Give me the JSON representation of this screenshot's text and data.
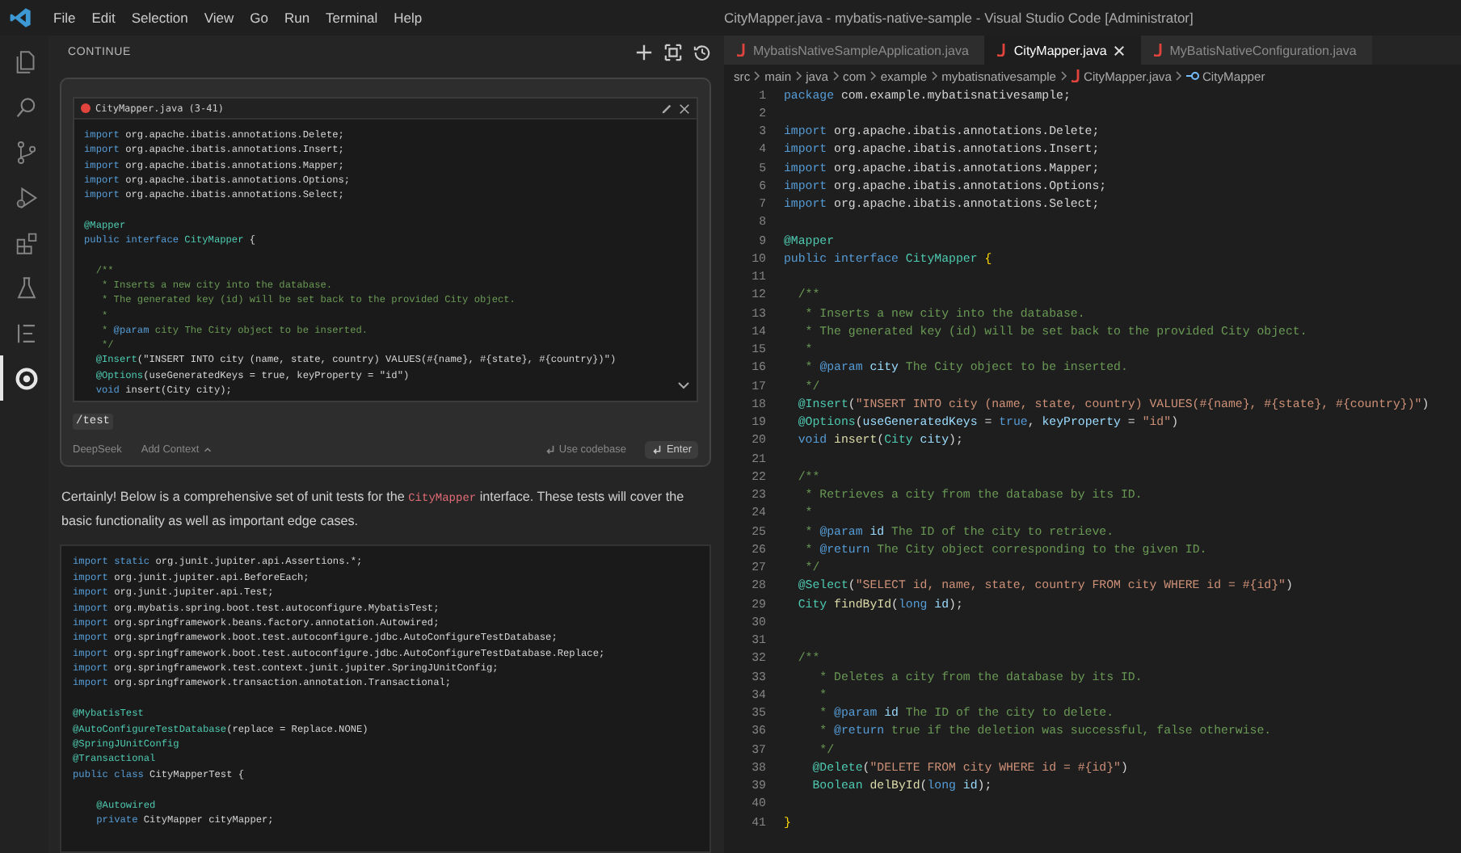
{
  "menu": [
    "File",
    "Edit",
    "Selection",
    "View",
    "Go",
    "Run",
    "Terminal",
    "Help"
  ],
  "window": {
    "title": "CityMapper.java - mybatis-native-sample - Visual Studio Code [Administrator]"
  },
  "activity_bar": [
    {
      "kind": "files",
      "selected": false
    },
    {
      "kind": "search",
      "selected": false
    },
    {
      "kind": "source-control",
      "selected": false
    },
    {
      "kind": "run",
      "selected": false
    },
    {
      "kind": "extensions",
      "selected": false
    },
    {
      "kind": "flask",
      "selected": false
    },
    {
      "kind": "outline",
      "selected": false
    },
    {
      "kind": "continue",
      "selected": true
    }
  ],
  "sidebar": {
    "title": "CONTINUE",
    "input": {
      "context": {
        "label": "CityMapper.java (3-41)",
        "lines": [
          {
            "kind": "code",
            "tokens": [
              {
                "kind": "keyword",
                "text": "import "
              },
              {
                "kind": "plain",
                "text": "org.apache.ibatis.annotations.Delete;"
              }
            ]
          },
          {
            "kind": "code",
            "tokens": [
              {
                "kind": "keyword",
                "text": "import "
              },
              {
                "kind": "plain",
                "text": "org.apache.ibatis.annotations.Insert;"
              }
            ]
          },
          {
            "kind": "code",
            "tokens": [
              {
                "kind": "keyword",
                "text": "import "
              },
              {
                "kind": "plain",
                "text": "org.apache.ibatis.annotations.Mapper;"
              }
            ]
          },
          {
            "kind": "code",
            "tokens": [
              {
                "kind": "keyword",
                "text": "import "
              },
              {
                "kind": "plain",
                "text": "org.apache.ibatis.annotations.Options;"
              }
            ]
          },
          {
            "kind": "code",
            "tokens": [
              {
                "kind": "keyword",
                "text": "import "
              },
              {
                "kind": "plain",
                "text": "org.apache.ibatis.annotations.Select;"
              }
            ]
          },
          {
            "kind": "blank"
          },
          {
            "kind": "code",
            "tokens": [
              {
                "kind": "type",
                "text": "@Mapper"
              }
            ]
          },
          {
            "kind": "code",
            "tokens": [
              {
                "kind": "keyword",
                "text": "public interface "
              },
              {
                "kind": "type",
                "text": "CityMapper "
              },
              {
                "kind": "plain",
                "text": "{"
              }
            ]
          },
          {
            "kind": "blank"
          },
          {
            "kind": "code",
            "tokens": [
              {
                "kind": "comment",
                "text": "  /**"
              }
            ]
          },
          {
            "kind": "code",
            "tokens": [
              {
                "kind": "comment",
                "text": "   * Inserts a new city into the database."
              }
            ]
          },
          {
            "kind": "code",
            "tokens": [
              {
                "kind": "comment",
                "text": "   * The generated key (id) will be set back to the provided City object."
              }
            ]
          },
          {
            "kind": "code",
            "tokens": [
              {
                "kind": "comment",
                "text": "   *"
              }
            ]
          },
          {
            "kind": "code",
            "tokens": [
              {
                "kind": "comment",
                "text": "   * "
              },
              {
                "kind": "doctag",
                "text": "@param"
              },
              {
                "kind": "comment",
                "text": " city The City object to be inserted."
              }
            ]
          },
          {
            "kind": "code",
            "tokens": [
              {
                "kind": "comment",
                "text": "   */"
              }
            ]
          },
          {
            "kind": "code",
            "tokens": [
              {
                "kind": "type",
                "text": "  @Insert"
              },
              {
                "kind": "plain",
                "text": "(\"INSERT INTO city (name, state, country) VALUES(#{name}, #{state}, #{country})\")"
              }
            ]
          },
          {
            "kind": "code",
            "tokens": [
              {
                "kind": "type",
                "text": "  @Options"
              },
              {
                "kind": "plain",
                "text": "(useGeneratedKeys = true, keyProperty = \"id\")"
              }
            ]
          },
          {
            "kind": "code",
            "tokens": [
              {
                "kind": "keyword",
                "text": "  void "
              },
              {
                "kind": "plain",
                "text": "insert(City city);"
              }
            ]
          }
        ]
      },
      "command": "/test",
      "model": "DeepSeek",
      "add_context": "Add Context",
      "codebase": "Use codebase",
      "submit": "Enter"
    },
    "response": [
      {
        "kind": "text",
        "text": "Certainly! Below is a comprehensive set of unit tests for the "
      },
      {
        "kind": "code",
        "text": "CityMapper"
      },
      {
        "kind": "text",
        "text": " interface. These tests will cover the basic functionality as well as important edge cases."
      }
    ],
    "code_block": [
      {
        "kind": "code",
        "tokens": [
          {
            "kind": "keyword",
            "text": "import static "
          },
          {
            "kind": "plain",
            "text": "org.junit.jupiter.api.Assertions.*;"
          }
        ]
      },
      {
        "kind": "code",
        "tokens": [
          {
            "kind": "keyword",
            "text": "import "
          },
          {
            "kind": "plain",
            "text": "org.junit.jupiter.api.BeforeEach;"
          }
        ]
      },
      {
        "kind": "code",
        "tokens": [
          {
            "kind": "keyword",
            "text": "import "
          },
          {
            "kind": "plain",
            "text": "org.junit.jupiter.api.Test;"
          }
        ]
      },
      {
        "kind": "code",
        "tokens": [
          {
            "kind": "keyword",
            "text": "import "
          },
          {
            "kind": "plain",
            "text": "org.mybatis.spring.boot.test.autoconfigure.MybatisTest;"
          }
        ]
      },
      {
        "kind": "code",
        "tokens": [
          {
            "kind": "keyword",
            "text": "import "
          },
          {
            "kind": "plain",
            "text": "org.springframework.beans.factory.annotation.Autowired;"
          }
        ]
      },
      {
        "kind": "code",
        "tokens": [
          {
            "kind": "keyword",
            "text": "import "
          },
          {
            "kind": "plain",
            "text": "org.springframework.boot.test.autoconfigure.jdbc.AutoConfigureTestDatabase;"
          }
        ]
      },
      {
        "kind": "code",
        "tokens": [
          {
            "kind": "keyword",
            "text": "import "
          },
          {
            "kind": "plain",
            "text": "org.springframework.boot.test.autoconfigure.jdbc.AutoConfigureTestDatabase.Replace;"
          }
        ]
      },
      {
        "kind": "code",
        "tokens": [
          {
            "kind": "keyword",
            "text": "import "
          },
          {
            "kind": "plain",
            "text": "org.springframework.test.context.junit.jupiter.SpringJUnitConfig;"
          }
        ]
      },
      {
        "kind": "code",
        "tokens": [
          {
            "kind": "keyword",
            "text": "import "
          },
          {
            "kind": "plain",
            "text": "org.springframework.transaction.annotation.Transactional;"
          }
        ]
      },
      {
        "kind": "blank"
      },
      {
        "kind": "code",
        "tokens": [
          {
            "kind": "type",
            "text": "@MybatisTest"
          }
        ]
      },
      {
        "kind": "code",
        "tokens": [
          {
            "kind": "type",
            "text": "@AutoConfigureTestDatabase"
          },
          {
            "kind": "plain",
            "text": "(replace = Replace.NONE)"
          }
        ]
      },
      {
        "kind": "code",
        "tokens": [
          {
            "kind": "type",
            "text": "@SpringJUnitConfig"
          }
        ]
      },
      {
        "kind": "code",
        "tokens": [
          {
            "kind": "type",
            "text": "@Transactional"
          }
        ]
      },
      {
        "kind": "code",
        "tokens": [
          {
            "kind": "keyword",
            "text": "public class "
          },
          {
            "kind": "plain",
            "text": "CityMapperTest {"
          }
        ]
      },
      {
        "kind": "blank"
      },
      {
        "kind": "code",
        "tokens": [
          {
            "kind": "type",
            "text": "    @Autowired"
          }
        ]
      },
      {
        "kind": "code",
        "tokens": [
          {
            "kind": "keyword",
            "text": "    private "
          },
          {
            "kind": "plain",
            "text": "CityMapper cityMapper;"
          }
        ]
      }
    ]
  },
  "editor": {
    "tabs": [
      {
        "label": "MybatisNativeSampleApplication.java",
        "selected": false
      },
      {
        "label": "CityMapper.java",
        "selected": true
      },
      {
        "label": "MyBatisNativeConfiguration.java",
        "selected": false
      }
    ],
    "breadcrumbs": [
      {
        "kind": "folder",
        "label": "src"
      },
      {
        "kind": "folder",
        "label": "main"
      },
      {
        "kind": "folder",
        "label": "java"
      },
      {
        "kind": "folder",
        "label": "com"
      },
      {
        "kind": "folder",
        "label": "example"
      },
      {
        "kind": "folder",
        "label": "mybatisnativesample"
      },
      {
        "kind": "file",
        "label": "CityMapper.java"
      },
      {
        "kind": "interface",
        "label": "CityMapper"
      }
    ],
    "lines": [
      {
        "n": "1",
        "tokens": [
          {
            "kind": "keyword",
            "text": "package "
          },
          {
            "kind": "plain",
            "text": "com.example.mybatisnativesample;"
          }
        ]
      },
      {
        "n": "2"
      },
      {
        "n": "3",
        "tokens": [
          {
            "kind": "keyword",
            "text": "import "
          },
          {
            "kind": "plain",
            "text": "org.apache.ibatis.annotations.Delete;"
          }
        ]
      },
      {
        "n": "4",
        "tokens": [
          {
            "kind": "keyword",
            "text": "import "
          },
          {
            "kind": "plain",
            "text": "org.apache.ibatis.annotations.Insert;"
          }
        ]
      },
      {
        "n": "5",
        "tokens": [
          {
            "kind": "keyword",
            "text": "import "
          },
          {
            "kind": "plain",
            "text": "org.apache.ibatis.annotations.Mapper;"
          }
        ]
      },
      {
        "n": "6",
        "tokens": [
          {
            "kind": "keyword",
            "text": "import "
          },
          {
            "kind": "plain",
            "text": "org.apache.ibatis.annotations.Options;"
          }
        ]
      },
      {
        "n": "7",
        "tokens": [
          {
            "kind": "keyword",
            "text": "import "
          },
          {
            "kind": "plain",
            "text": "org.apache.ibatis.annotations.Select;"
          }
        ]
      },
      {
        "n": "8"
      },
      {
        "n": "9",
        "tokens": [
          {
            "kind": "type",
            "text": "@Mapper"
          }
        ]
      },
      {
        "n": "10",
        "tokens": [
          {
            "kind": "keyword",
            "text": "public interface "
          },
          {
            "kind": "type",
            "text": "CityMapper "
          },
          {
            "kind": "brace",
            "text": "{"
          }
        ]
      },
      {
        "n": "11"
      },
      {
        "n": "12",
        "tokens": [
          {
            "kind": "comment",
            "text": "  /**"
          }
        ]
      },
      {
        "n": "13",
        "tokens": [
          {
            "kind": "comment",
            "text": "   * Inserts a new city into the database."
          }
        ]
      },
      {
        "n": "14",
        "tokens": [
          {
            "kind": "comment",
            "text": "   * The generated key (id) will be set back to the provided City object."
          }
        ]
      },
      {
        "n": "15",
        "tokens": [
          {
            "kind": "comment",
            "text": "   *"
          }
        ]
      },
      {
        "n": "16",
        "tokens": [
          {
            "kind": "comment",
            "text": "   * "
          },
          {
            "kind": "doctag",
            "text": "@param "
          },
          {
            "kind": "param",
            "text": "city"
          },
          {
            "kind": "comment",
            "text": " The City object to be inserted."
          }
        ]
      },
      {
        "n": "17",
        "tokens": [
          {
            "kind": "comment",
            "text": "   */"
          }
        ]
      },
      {
        "n": "18",
        "tokens": [
          {
            "kind": "type",
            "text": "  @Insert"
          },
          {
            "kind": "plain",
            "text": "("
          },
          {
            "kind": "string",
            "text": "\"INSERT INTO city (name, state, country) VALUES(#{name}, #{state}, #{country})\""
          },
          {
            "kind": "plain",
            "text": ")"
          }
        ]
      },
      {
        "n": "19",
        "tokens": [
          {
            "kind": "type",
            "text": "  @Options"
          },
          {
            "kind": "plain",
            "text": "("
          },
          {
            "kind": "param",
            "text": "useGeneratedKeys"
          },
          {
            "kind": "plain",
            "text": " = "
          },
          {
            "kind": "keyword",
            "text": "true"
          },
          {
            "kind": "plain",
            "text": ", "
          },
          {
            "kind": "param",
            "text": "keyProperty"
          },
          {
            "kind": "plain",
            "text": " = "
          },
          {
            "kind": "string",
            "text": "\"id\""
          },
          {
            "kind": "plain",
            "text": ")"
          }
        ]
      },
      {
        "n": "20",
        "tokens": [
          {
            "kind": "keyword",
            "text": "  void "
          },
          {
            "kind": "function",
            "text": "insert"
          },
          {
            "kind": "plain",
            "text": "("
          },
          {
            "kind": "type",
            "text": "City "
          },
          {
            "kind": "param",
            "text": "city"
          },
          {
            "kind": "plain",
            "text": ");"
          }
        ]
      },
      {
        "n": "21"
      },
      {
        "n": "22",
        "tokens": [
          {
            "kind": "comment",
            "text": "  /**"
          }
        ]
      },
      {
        "n": "23",
        "tokens": [
          {
            "kind": "comment",
            "text": "   * Retrieves a city from the database by its ID."
          }
        ]
      },
      {
        "n": "24",
        "tokens": [
          {
            "kind": "comment",
            "text": "   *"
          }
        ]
      },
      {
        "n": "25",
        "tokens": [
          {
            "kind": "comment",
            "text": "   * "
          },
          {
            "kind": "doctag",
            "text": "@param "
          },
          {
            "kind": "param",
            "text": "id"
          },
          {
            "kind": "comment",
            "text": " The ID of the city to retrieve."
          }
        ]
      },
      {
        "n": "26",
        "tokens": [
          {
            "kind": "comment",
            "text": "   * "
          },
          {
            "kind": "doctag",
            "text": "@return"
          },
          {
            "kind": "comment",
            "text": " The City object corresponding to the given ID."
          }
        ]
      },
      {
        "n": "27",
        "tokens": [
          {
            "kind": "comment",
            "text": "   */"
          }
        ]
      },
      {
        "n": "28",
        "tokens": [
          {
            "kind": "type",
            "text": "  @Select"
          },
          {
            "kind": "plain",
            "text": "("
          },
          {
            "kind": "string",
            "text": "\"SELECT id, name, state, country FROM city WHERE id = #{id}\""
          },
          {
            "kind": "plain",
            "text": ")"
          }
        ]
      },
      {
        "n": "29",
        "tokens": [
          {
            "kind": "type",
            "text": "  City "
          },
          {
            "kind": "function",
            "text": "findById"
          },
          {
            "kind": "plain",
            "text": "("
          },
          {
            "kind": "keyword",
            "text": "long "
          },
          {
            "kind": "param",
            "text": "id"
          },
          {
            "kind": "plain",
            "text": ");"
          }
        ]
      },
      {
        "n": "30"
      },
      {
        "n": "31"
      },
      {
        "n": "32",
        "tokens": [
          {
            "kind": "comment",
            "text": "  /**"
          }
        ]
      },
      {
        "n": "33",
        "tokens": [
          {
            "kind": "comment",
            "text": "     * Deletes a city from the database by its ID."
          }
        ]
      },
      {
        "n": "34",
        "tokens": [
          {
            "kind": "comment",
            "text": "     *"
          }
        ]
      },
      {
        "n": "35",
        "tokens": [
          {
            "kind": "comment",
            "text": "     * "
          },
          {
            "kind": "doctag",
            "text": "@param "
          },
          {
            "kind": "param",
            "text": "id"
          },
          {
            "kind": "comment",
            "text": " The ID of the city to delete."
          }
        ]
      },
      {
        "n": "36",
        "tokens": [
          {
            "kind": "comment",
            "text": "     * "
          },
          {
            "kind": "doctag",
            "text": "@return"
          },
          {
            "kind": "comment",
            "text": " true if the deletion was successful, false otherwise."
          }
        ]
      },
      {
        "n": "37",
        "tokens": [
          {
            "kind": "comment",
            "text": "     */"
          }
        ]
      },
      {
        "n": "38",
        "tokens": [
          {
            "kind": "type",
            "text": "    @Delete"
          },
          {
            "kind": "plain",
            "text": "("
          },
          {
            "kind": "string",
            "text": "\"DELETE FROM city WHERE id = #{id}\""
          },
          {
            "kind": "plain",
            "text": ")"
          }
        ]
      },
      {
        "n": "39",
        "tokens": [
          {
            "kind": "type",
            "text": "    Boolean "
          },
          {
            "kind": "function",
            "text": "delById"
          },
          {
            "kind": "plain",
            "text": "("
          },
          {
            "kind": "keyword",
            "text": "long "
          },
          {
            "kind": "param",
            "text": "id"
          },
          {
            "kind": "plain",
            "text": ");"
          }
        ]
      },
      {
        "n": "40"
      },
      {
        "n": "41",
        "tokens": [
          {
            "kind": "brace",
            "text": "}"
          }
        ]
      }
    ]
  }
}
